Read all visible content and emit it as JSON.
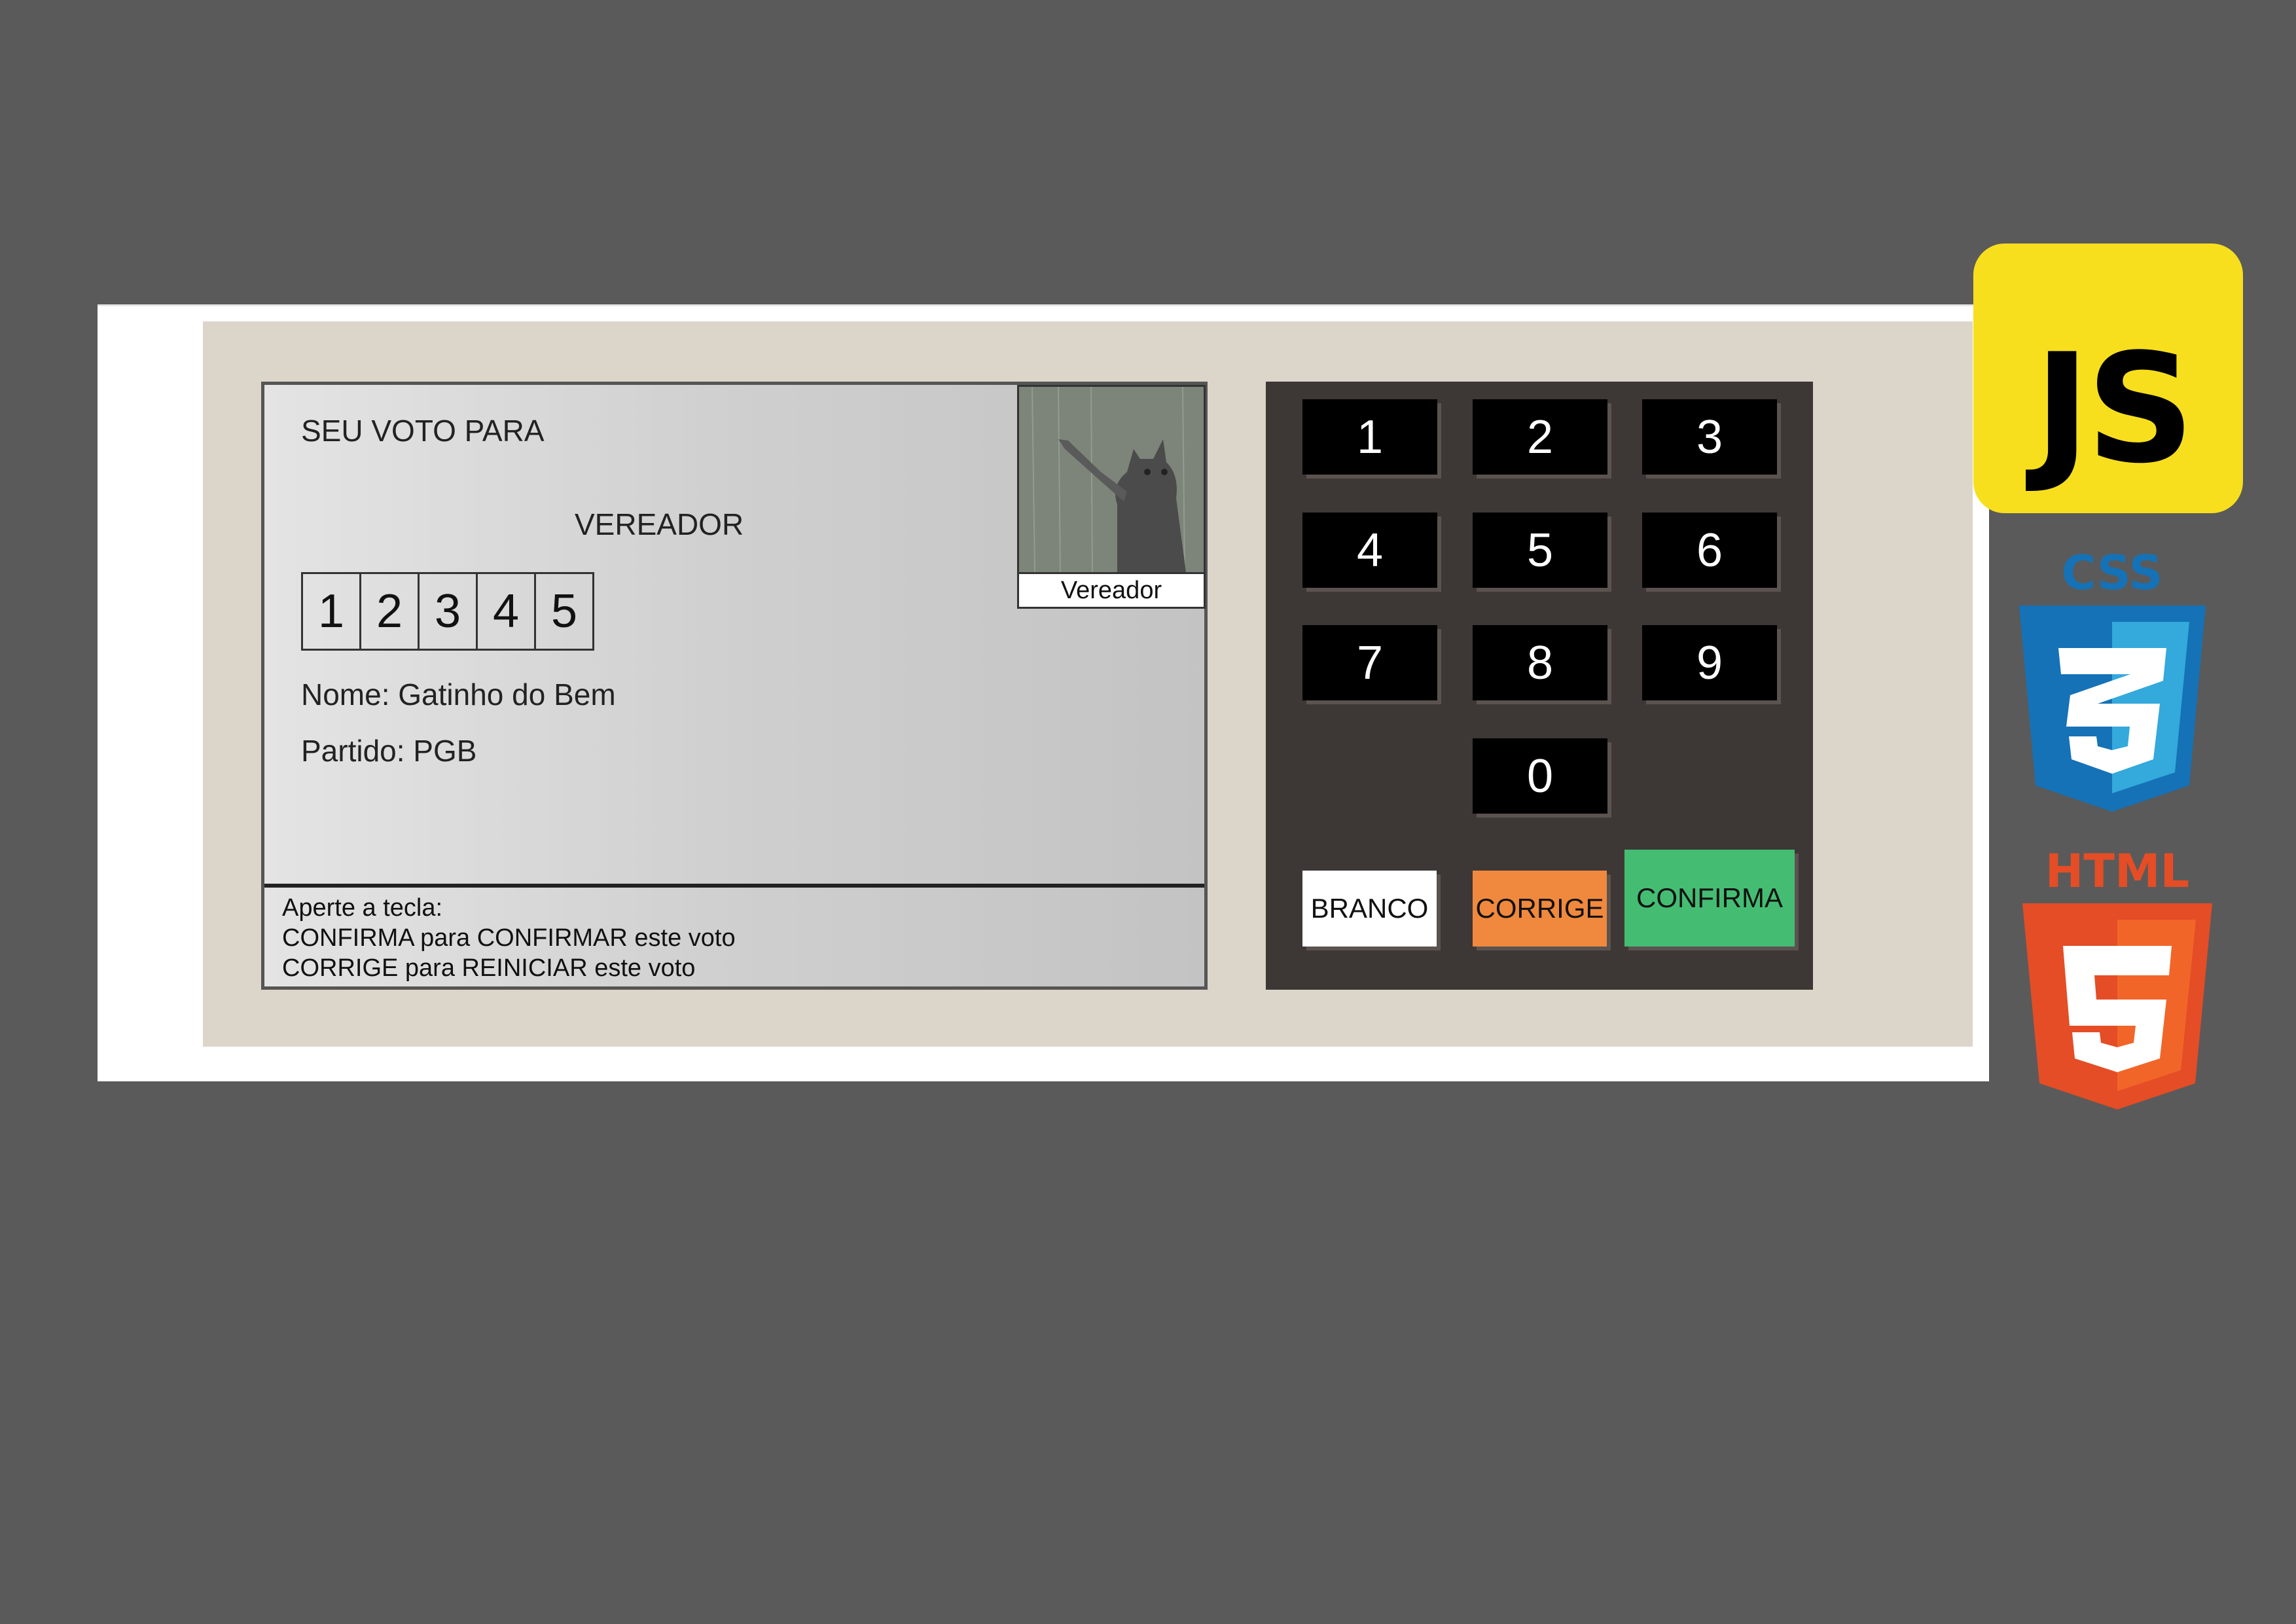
{
  "screen": {
    "vote_label": "SEU VOTO PARA",
    "office": "VEREADOR",
    "digits": [
      "1",
      "2",
      "3",
      "4",
      "5"
    ],
    "candidate_name": "Nome: Gatinho do Bem",
    "candidate_party": "Partido: PGB",
    "photo_caption": "Vereador",
    "instructions": [
      "Aperte a tecla:",
      "CONFIRMA para CONFIRMAR este voto",
      "CORRIGE para REINICIAR este voto"
    ]
  },
  "keypad": {
    "keys": [
      "1",
      "2",
      "3",
      "4",
      "5",
      "6",
      "7",
      "8",
      "9",
      "0"
    ],
    "branco_label": "BRANCO",
    "corrige_label": "CORRIGE",
    "confirma_label": "CONFIRMA"
  },
  "badges": {
    "js_label": "JS",
    "css_label": "CSS",
    "html_label": "HTML"
  },
  "colors": {
    "branco": "#ffffff",
    "corrige": "#f0893d",
    "confirma": "#44bd73",
    "js": "#f7df1e",
    "css": "#1572b6",
    "html": "#e44d26"
  }
}
